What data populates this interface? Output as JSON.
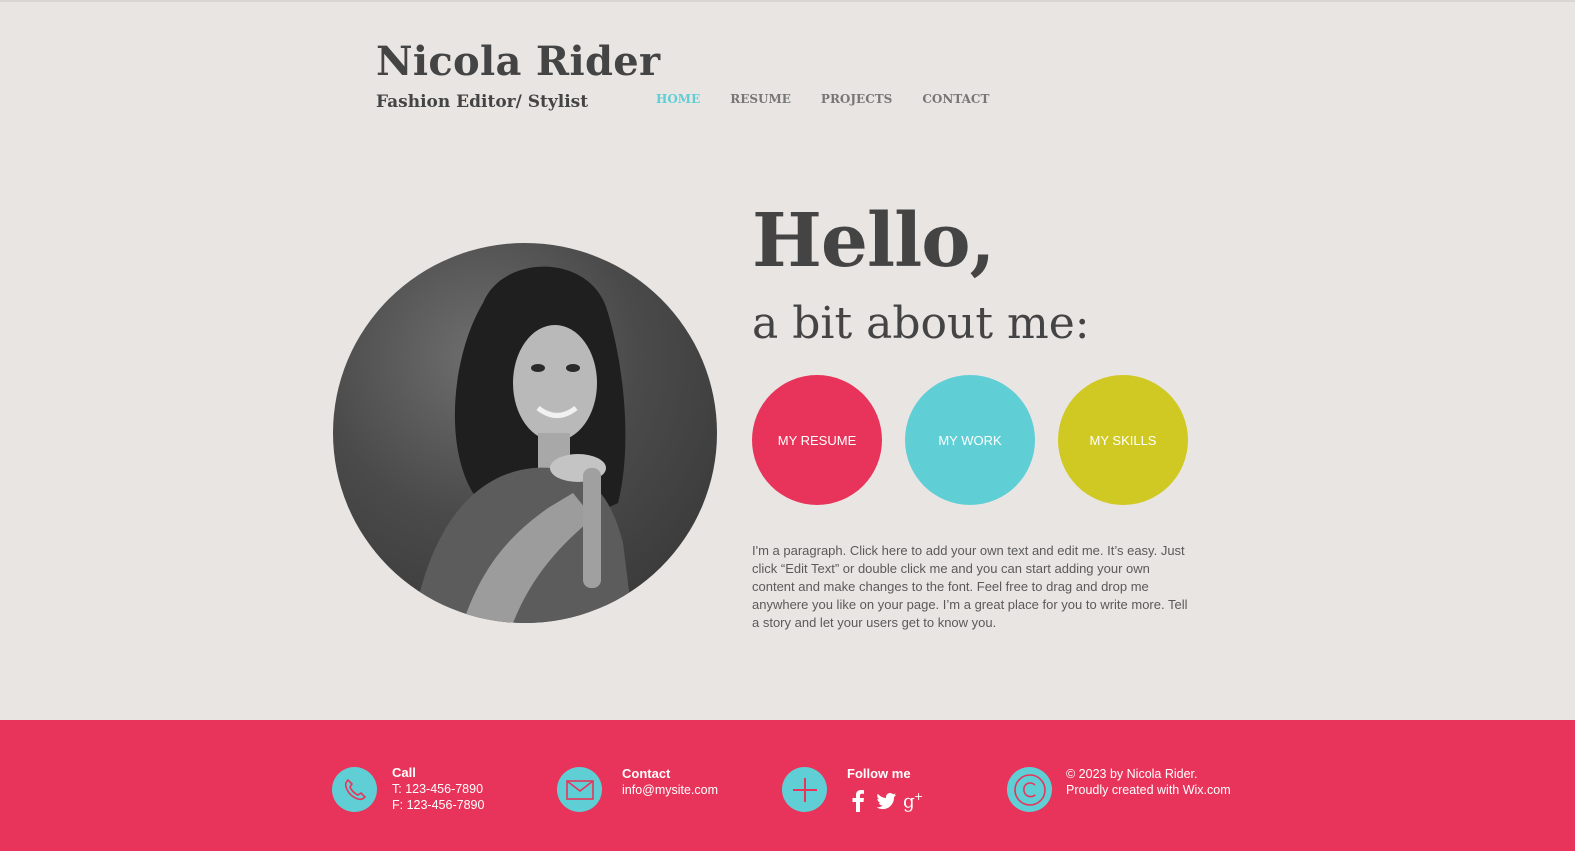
{
  "header": {
    "title": "Nicola Rider",
    "subtitle": "Fashion Editor/ Stylist"
  },
  "nav": {
    "items": [
      {
        "label": "HOME",
        "active": true
      },
      {
        "label": "RESUME",
        "active": false
      },
      {
        "label": "PROJECTS",
        "active": false
      },
      {
        "label": "CONTACT",
        "active": false
      }
    ]
  },
  "hero": {
    "greeting": "Hello,",
    "tagline": "a bit about me:",
    "photo_icon": "portrait-photo"
  },
  "circle_buttons": {
    "resume": "MY RESUME",
    "work": "MY WORK",
    "skills": "MY SKILLS"
  },
  "paragraph": "I'm a paragraph. Click here to add your own text and edit me. It’s easy. Just click “Edit Text” or double click me and you can start adding your own content and make changes to the font. Feel free to drag and drop me anywhere you like on your page. I’m a great place for you to write more. Tell a story and let your users get to know you.",
  "footer": {
    "call": {
      "heading": "Call",
      "phone": "T: 123-456-7890",
      "fax": "F: 123-456-7890"
    },
    "contact": {
      "heading": "Contact",
      "email": "info@mysite.com"
    },
    "follow": {
      "heading": "Follow me",
      "icons": [
        "facebook-icon",
        "twitter-icon",
        "google-plus-icon"
      ]
    },
    "copyright": {
      "line1": "© 2023 by Nicola Rider.",
      "line2": "Proudly created with Wix.com"
    }
  },
  "colors": {
    "background": "#e9e5e3",
    "accent_pink": "#e8345a",
    "accent_teal": "#5fcfd5",
    "accent_yellow": "#d0c924",
    "text_dark": "#444444"
  }
}
